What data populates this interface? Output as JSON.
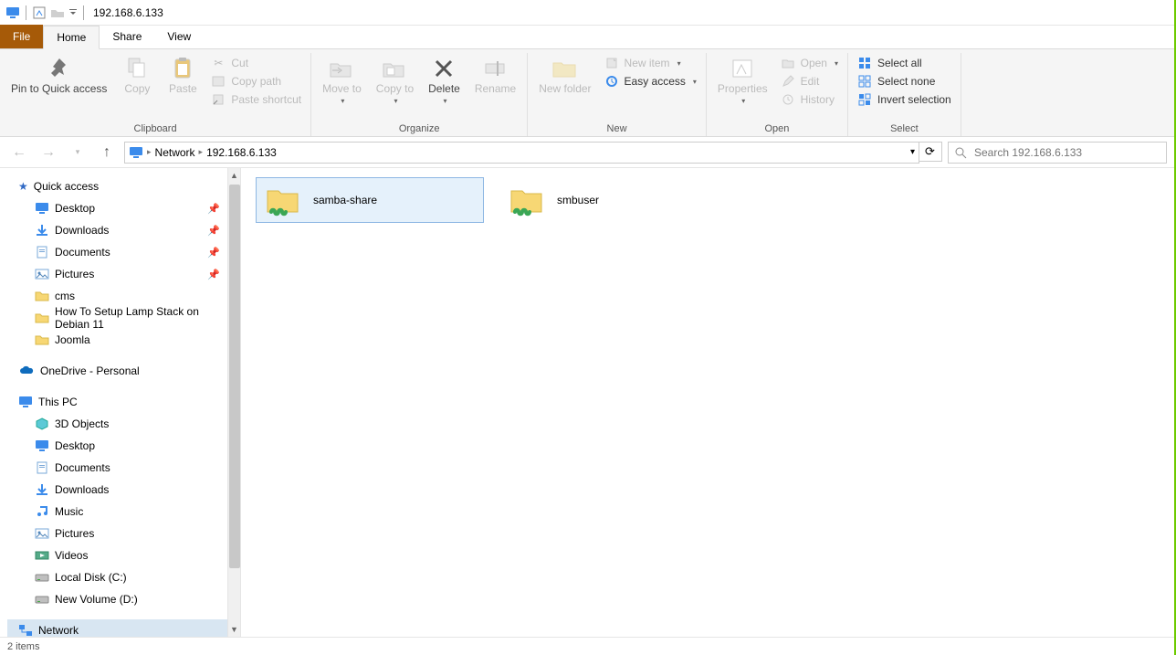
{
  "titlebar": {
    "address": "192.168.6.133"
  },
  "tabs": {
    "file": "File",
    "home": "Home",
    "share": "Share",
    "view": "View"
  },
  "ribbon": {
    "clipboard": {
      "label": "Clipboard",
      "pin": "Pin to Quick access",
      "copy": "Copy",
      "paste": "Paste",
      "cut": "Cut",
      "copypath": "Copy path",
      "pastesc": "Paste shortcut"
    },
    "organize": {
      "label": "Organize",
      "moveto": "Move to",
      "copyto": "Copy to",
      "delete": "Delete",
      "rename": "Rename"
    },
    "new": {
      "label": "New",
      "newfolder": "New folder",
      "newitem": "New item",
      "easyaccess": "Easy access"
    },
    "open": {
      "label": "Open",
      "properties": "Properties",
      "open": "Open",
      "edit": "Edit",
      "history": "History"
    },
    "select": {
      "label": "Select",
      "all": "Select all",
      "none": "Select none",
      "invert": "Invert selection"
    }
  },
  "breadcrumb": {
    "root": "Network",
    "leaf": "192.168.6.133"
  },
  "search": {
    "placeholder": "Search 192.168.6.133"
  },
  "nav": {
    "quick": "Quick access",
    "quick_items": [
      "Desktop",
      "Downloads",
      "Documents",
      "Pictures",
      "cms",
      "How To Setup Lamp Stack on Debian 11",
      "Joomla"
    ],
    "onedrive": "OneDrive - Personal",
    "thispc": "This PC",
    "pc_items": [
      "3D Objects",
      "Desktop",
      "Documents",
      "Downloads",
      "Music",
      "Pictures",
      "Videos",
      "Local Disk (C:)",
      "New Volume (D:)"
    ],
    "network": "Network"
  },
  "shares": [
    {
      "name": "samba-share",
      "selected": true
    },
    {
      "name": "smbuser",
      "selected": false
    }
  ],
  "status": "2 items"
}
